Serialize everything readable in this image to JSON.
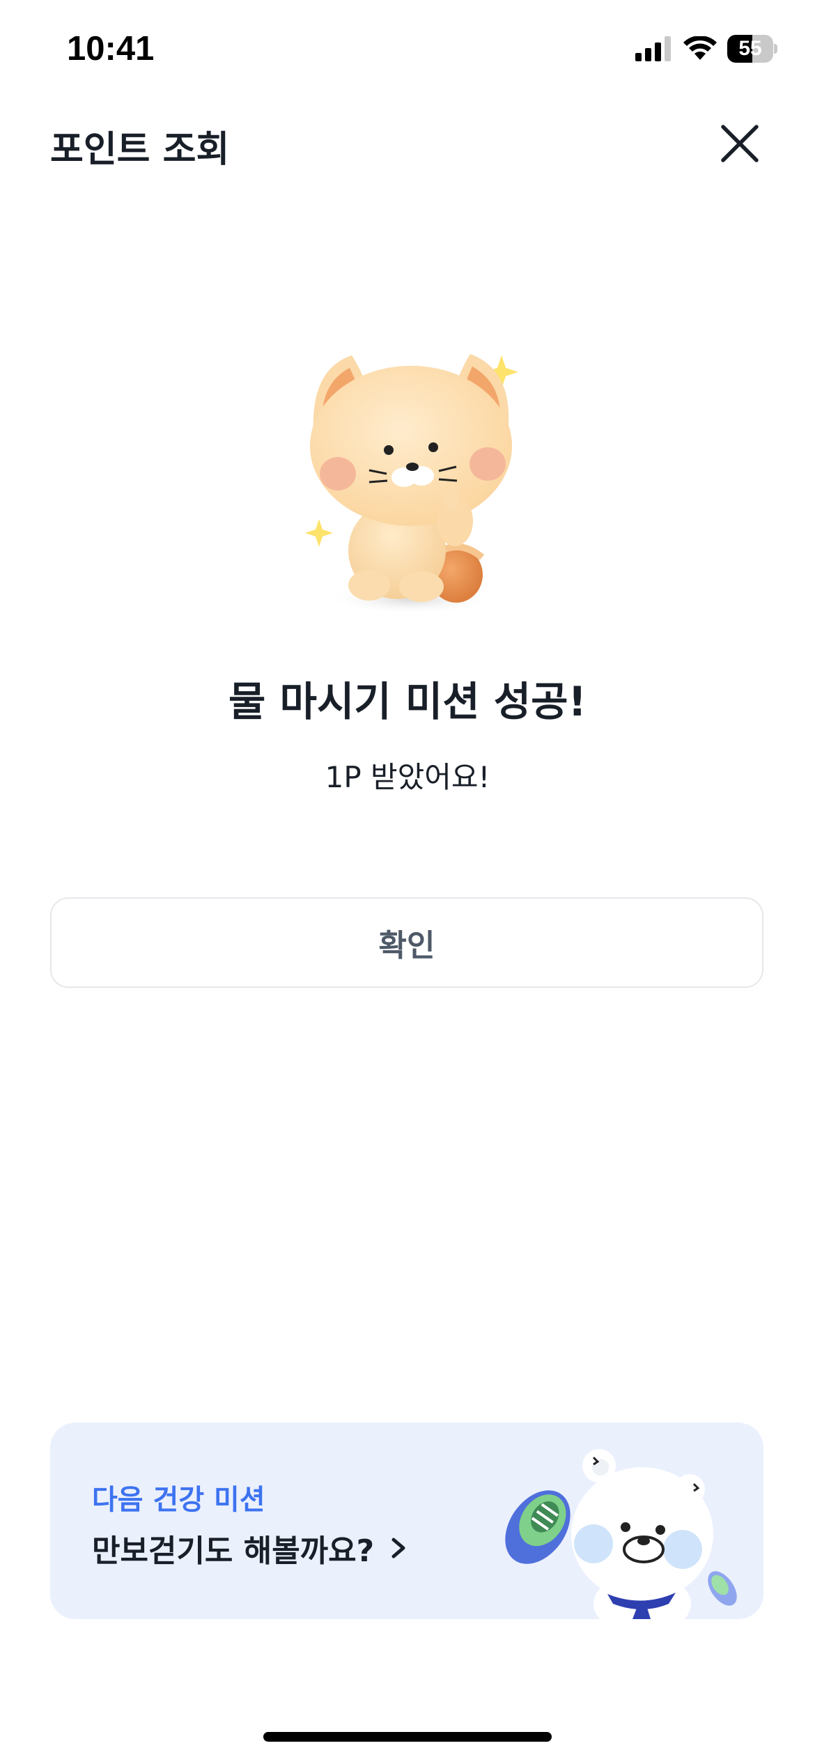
{
  "status_bar": {
    "time": "10:41",
    "battery_percent": "55",
    "battery_level": 0.55,
    "icons": [
      "cellular-signal-icon",
      "wifi-icon",
      "battery-icon"
    ]
  },
  "header": {
    "title": "포인트 조회",
    "close_icon": "close-icon"
  },
  "result": {
    "illustration": "cat-character-thumbs-up",
    "title": "물 마시기 미션 성공!",
    "subtitle": "1P 받았어요!"
  },
  "confirm_button": {
    "label": "확인"
  },
  "next_mission": {
    "caption": "다음 건강 미션",
    "title": "만보걷기도 해볼까요?",
    "arrow_icon": "chevron-right-icon",
    "illustration": "bear-character-with-sneakers"
  },
  "colors": {
    "accent_blue": "#3d73f0",
    "card_background": "#ebf0fd",
    "text_primary": "#191f28",
    "button_text": "#4e5968",
    "button_border": "#e5e8eb"
  }
}
